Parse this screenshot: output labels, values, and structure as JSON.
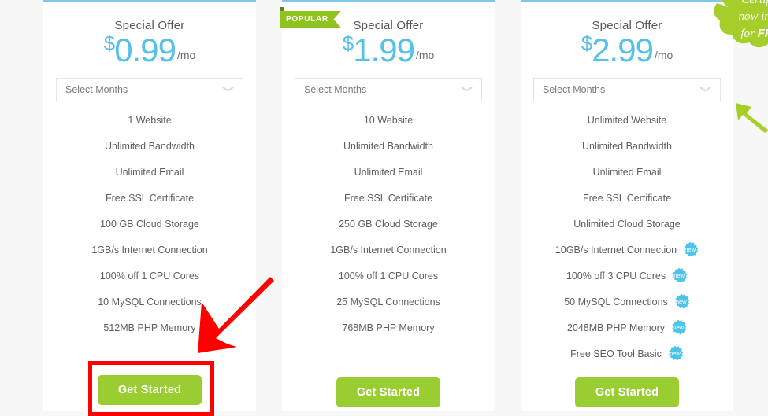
{
  "theme": {
    "page_background": "#f7f7f7",
    "card_background": "#ffffff",
    "card_top_border": "#7ec9e8",
    "price_color": "#56c1e8",
    "cta_color": "#9acd32",
    "ribbon_color": "#8fc320",
    "badge_color": "#4ec3e8",
    "annotation_color": "#ff0000",
    "splash_color": "#a6ce2a"
  },
  "plans": [
    {
      "badge": null,
      "offer_label": "Special Offer",
      "currency": "$",
      "price": "0.99",
      "period": "/mo",
      "select": {
        "value": "Select Months",
        "placeholder": "Select Months",
        "icon": "chevron-down-icon"
      },
      "features": [
        {
          "text": "1 Website",
          "new": false
        },
        {
          "text": "Unlimited Bandwidth",
          "new": false
        },
        {
          "text": "Unlimited Email",
          "new": false
        },
        {
          "text": "Free SSL Certificate",
          "new": false
        },
        {
          "text": "100 GB Cloud Storage",
          "new": false
        },
        {
          "text": "1GB/s Internet Connection",
          "new": false
        },
        {
          "text": "100% off 1 CPU Cores",
          "new": false
        },
        {
          "text": "10 MySQL Connections",
          "new": false
        },
        {
          "text": "512MB PHP Memory",
          "new": false
        }
      ],
      "cta_label": "Get Started"
    },
    {
      "badge": "POPULAR",
      "offer_label": "Special Offer",
      "currency": "$",
      "price": "1.99",
      "period": "/mo",
      "select": {
        "value": "Select Months",
        "placeholder": "Select Months",
        "icon": "chevron-down-icon"
      },
      "features": [
        {
          "text": "10 Website",
          "new": false
        },
        {
          "text": "Unlimited Bandwidth",
          "new": false
        },
        {
          "text": "Unlimited Email",
          "new": false
        },
        {
          "text": "Free SSL Certificate",
          "new": false
        },
        {
          "text": "250 GB Cloud Storage",
          "new": false
        },
        {
          "text": "1GB/s Internet Connection",
          "new": false
        },
        {
          "text": "100% off 1 CPU Cores",
          "new": false
        },
        {
          "text": "25 MySQL Connections",
          "new": false
        },
        {
          "text": "768MB PHP Memory",
          "new": false
        }
      ],
      "cta_label": "Get Started"
    },
    {
      "badge": null,
      "offer_label": "Special Offer",
      "currency": "$",
      "price": "2.99",
      "period": "/mo",
      "select": {
        "value": "Select Months",
        "placeholder": "Select Months",
        "icon": "chevron-down-icon"
      },
      "features": [
        {
          "text": "Unlimited Website",
          "new": false
        },
        {
          "text": "Unlimited Bandwidth",
          "new": false
        },
        {
          "text": "Unlimited Email",
          "new": false
        },
        {
          "text": "Free SSL Certificate",
          "new": false
        },
        {
          "text": "Unlimited Cloud Storage",
          "new": false
        },
        {
          "text": "10GB/s Internet Connection",
          "new": true
        },
        {
          "text": "100% off 3 CPU Cores",
          "new": true
        },
        {
          "text": "50 MySQL Connections",
          "new": true
        },
        {
          "text": "2048MB PHP Memory",
          "new": true
        },
        {
          "text": "Free SEO Tool Basic",
          "new": true
        }
      ],
      "cta_label": "Get Started"
    }
  ],
  "badge_label": "new",
  "promo_splash": {
    "line1": "Certifi",
    "line2": "now inc",
    "line3_prefix": "for ",
    "line3_bold": "FR"
  },
  "annotations": {
    "red_arrow": "red-arrow-pointing-to-get-started",
    "red_box": "red-highlight-around-get-started",
    "green_arrow": "green-arrow-pointing-to-plan"
  }
}
